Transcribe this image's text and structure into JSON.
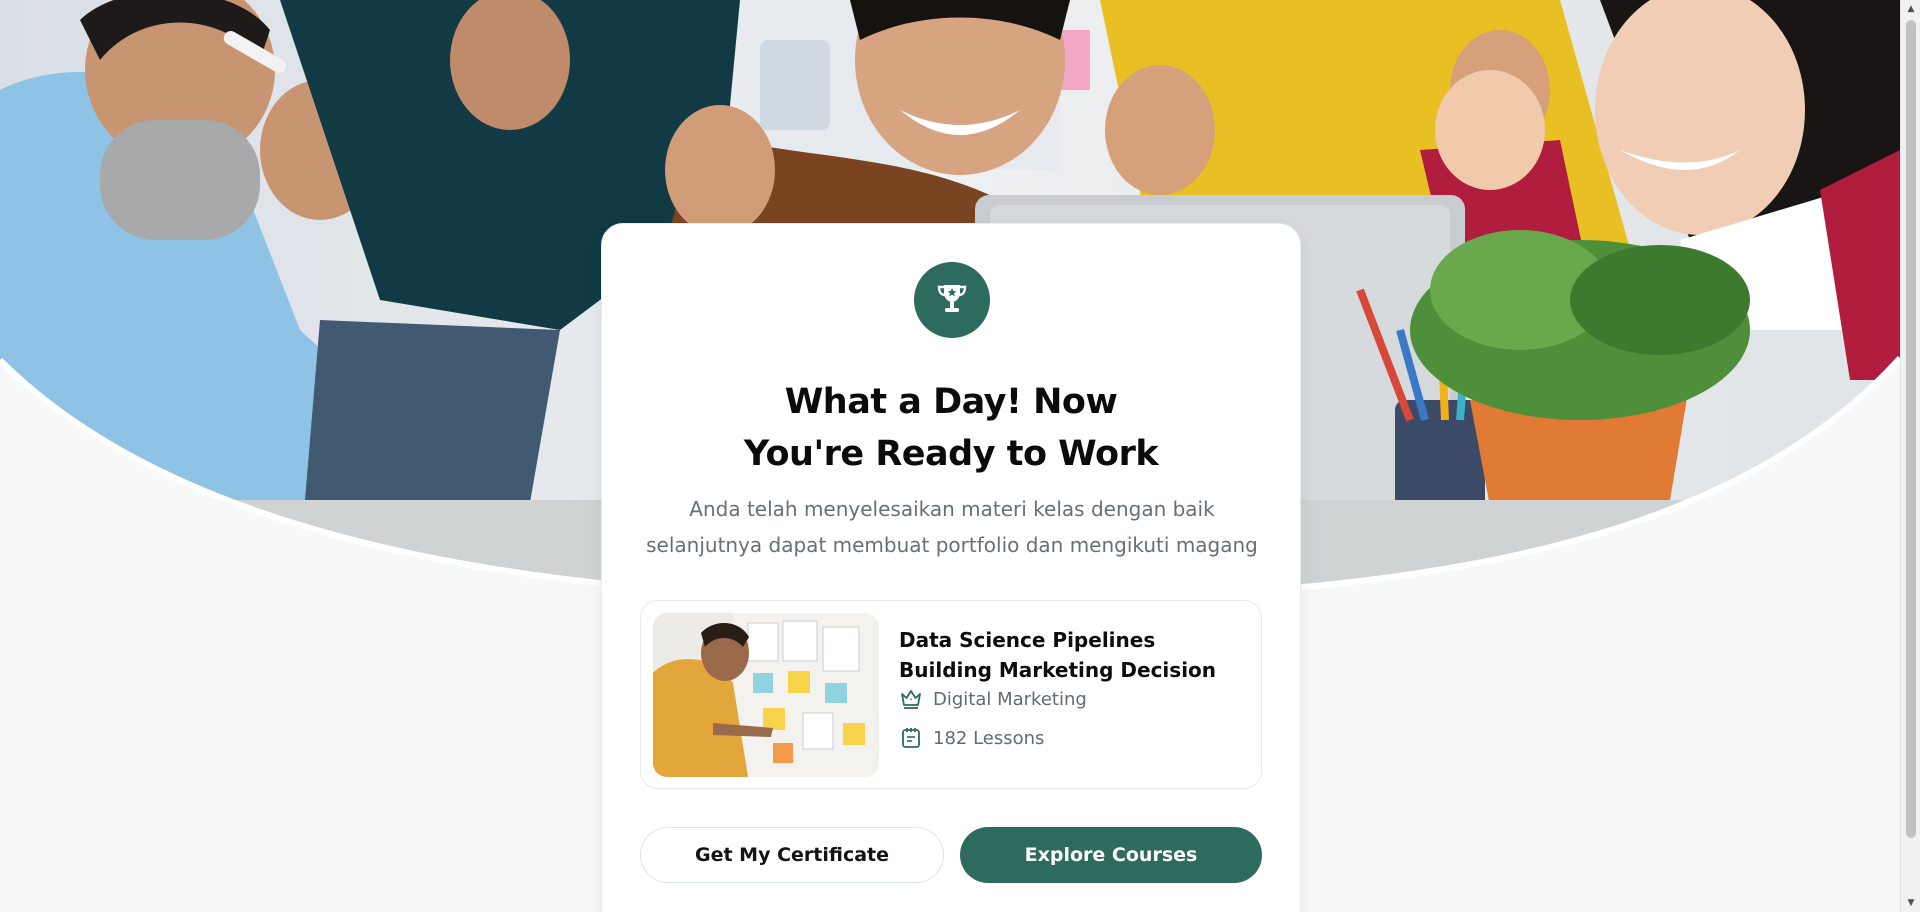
{
  "hero": {
    "image": "hero-photo-team-celebrating-at-laptop"
  },
  "card": {
    "icon": "trophy-icon",
    "title_line1": "What a Day! Now",
    "title_line2": "You're Ready to Work",
    "subtitle_line1": "Anda telah menyelesaikan materi kelas dengan baik",
    "subtitle_line2": "selanjutnya dapat membuat portfolio dan mengikuti magang",
    "course": {
      "thumbnail": "man-at-whiteboard-with-sticky-notes",
      "title": "Data Science Pipelines Building Marketing Decision",
      "category_icon": "crown-icon",
      "category": "Digital Marketing",
      "lessons_icon": "notebook-icon",
      "lessons": "182 Lessons"
    },
    "buttons": {
      "certificate": "Get My Certificate",
      "explore": "Explore Courses"
    }
  },
  "colors": {
    "brand": "#2e6b5f",
    "page_bg": "#f7f9f8"
  }
}
